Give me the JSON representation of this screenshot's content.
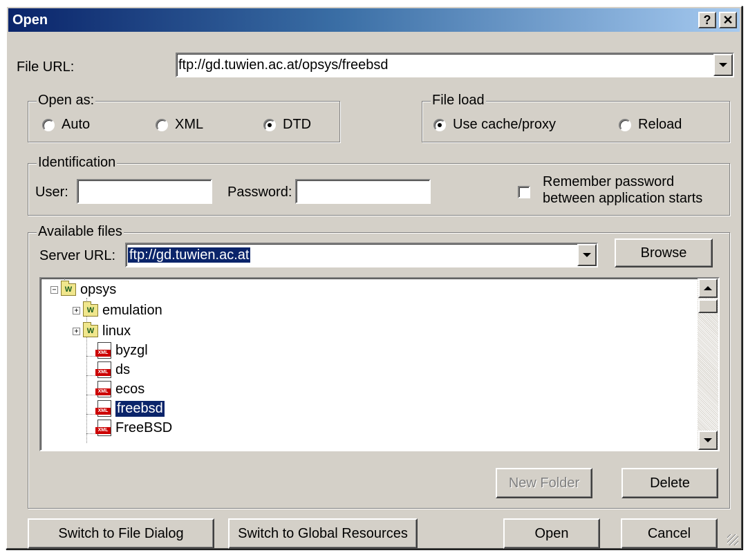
{
  "dialog": {
    "title": "Open",
    "help_label": "?",
    "close_label": "✕"
  },
  "file_url": {
    "label": "File URL:",
    "value": "ftp://gd.tuwien.ac.at/opsys/freebsd"
  },
  "open_as": {
    "title": "Open as:",
    "options": [
      "Auto",
      "XML",
      "DTD"
    ],
    "selected": "DTD"
  },
  "file_load": {
    "title": "File load",
    "options": [
      "Use cache/proxy",
      "Reload"
    ],
    "selected": "Use cache/proxy"
  },
  "identification": {
    "title": "Identification",
    "user_label": "User:",
    "user_value": "",
    "password_label": "Password:",
    "password_value": "",
    "remember_line1": "Remember password",
    "remember_line2": "between application starts",
    "remember_checked": false
  },
  "available_files": {
    "title": "Available files",
    "server_label": "Server URL:",
    "server_value": "ftp://gd.tuwien.ac.at",
    "browse_label": "Browse",
    "tree": {
      "root": {
        "label": "opsys",
        "expander": "−",
        "icon": "folder-icon"
      },
      "children": [
        {
          "label": "emulation",
          "expander": "+",
          "icon": "folder-icon"
        },
        {
          "label": "linux",
          "expander": "+",
          "icon": "folder-icon"
        },
        {
          "label": "byzgl",
          "icon": "xml-file-icon"
        },
        {
          "label": "ds",
          "icon": "xml-file-icon"
        },
        {
          "label": "ecos",
          "icon": "xml-file-icon"
        },
        {
          "label": "freebsd",
          "icon": "xml-file-icon",
          "selected": true
        },
        {
          "label": "FreeBSD",
          "icon": "xml-file-icon"
        }
      ],
      "folder_badge": "W",
      "file_badge": "XML"
    },
    "new_folder_label": "New Folder",
    "delete_label": "Delete"
  },
  "footer": {
    "switch_file_label": "Switch to File Dialog",
    "switch_global_label": "Switch to Global Resources",
    "open_label": "Open",
    "cancel_label": "Cancel"
  },
  "colors": {
    "face": "#d4d0c8",
    "title_start": "#0a246a",
    "title_end": "#a6caf0",
    "selection": "#0a246a"
  }
}
